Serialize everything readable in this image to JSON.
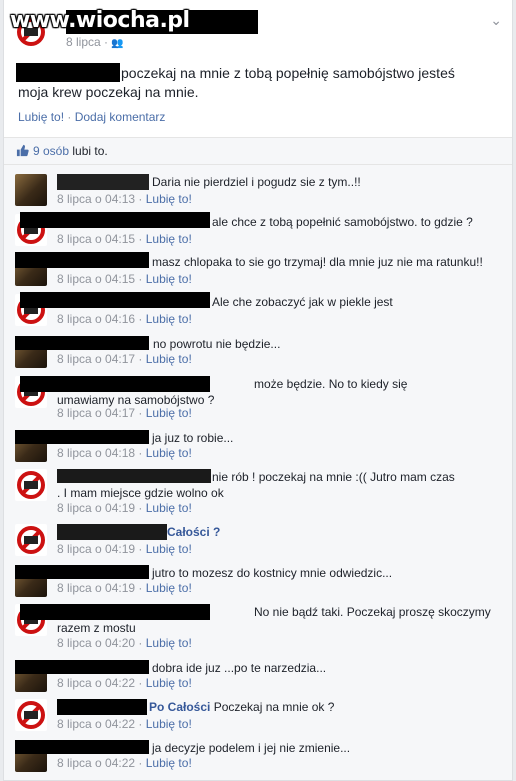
{
  "watermark": "www.wiocha.pl",
  "post": {
    "date": "8 lipca · ",
    "text": "poczekaj na mnie z tobą popełnię samobójstwo jesteś moja krew poczekaj na mnie.",
    "like_action": "Lubię to!",
    "comment_action": "Dodaj komentarz",
    "separator": " · "
  },
  "likes": {
    "count": "9 osób",
    "suffix": " lubi to."
  },
  "comments": [
    {
      "text": "Daria nie pierdziel i pogudz sie z tym..!!",
      "date": "8 lipca o 04:13",
      "like": "Lubię to!"
    },
    {
      "text": "ale chce z tobą popełnić samobójstwo. to gdzie ?",
      "date": "8 lipca o 04:15",
      "like": "Lubię to!"
    },
    {
      "text": "masz chlopaka to sie go trzymaj! dla mnie juz nie ma ratunku!!",
      "date": "8 lipca o 04:15",
      "like": "Lubię to!"
    },
    {
      "text": "Ale che zobaczyć jak w piekle jest",
      "date": "8 lipca o 04:16",
      "like": "Lubię to!"
    },
    {
      "text": "no powrotu nie będzie...",
      "date": "8 lipca o 04:17",
      "like": "Lubię to!"
    },
    {
      "text": "może będzie. No to kiedy się umawiamy na samobójstwo ?",
      "date": "8 lipca o 04:17",
      "like": "Lubię to!"
    },
    {
      "text": "ja juz to robie...",
      "date": "8 lipca o 04:18",
      "like": "Lubię to!"
    },
    {
      "text": "nie rób ! poczekaj na mnie :(( Jutro mam czas . I mam miejsce gdzie wolno ok",
      "date": "8 lipca o 04:19",
      "like": "Lubię to!"
    },
    {
      "text": "Całości ?",
      "date": "8 lipca o 04:19",
      "like": "Lubię to!"
    },
    {
      "text": "jutro to mozesz do kostnicy mnie odwiedzic...",
      "date": "8 lipca o 04:19",
      "like": "Lubię to!"
    },
    {
      "text": "No nie bądź taki. Poczekaj proszę skoczymy razem z mostu",
      "date": "8 lipca o 04:20",
      "like": "Lubię to!"
    },
    {
      "text": "dobra ide juz ...po te narzedzia...",
      "date": "8 lipca o 04:22",
      "like": "Lubię to!"
    },
    {
      "text": "Poczekaj na mnie ok ?",
      "name_fragment": "Po Całości",
      "date": "8 lipca o 04:22",
      "like": "Lubię to!"
    },
    {
      "text": "ja decyzje podelem i jej nie zmienie...",
      "date": "8 lipca o 04:22",
      "like": "Lubię to!"
    }
  ],
  "colors": {
    "link": "#4b6ea8",
    "meta": "#90949c",
    "background": "#f6f7f9"
  }
}
